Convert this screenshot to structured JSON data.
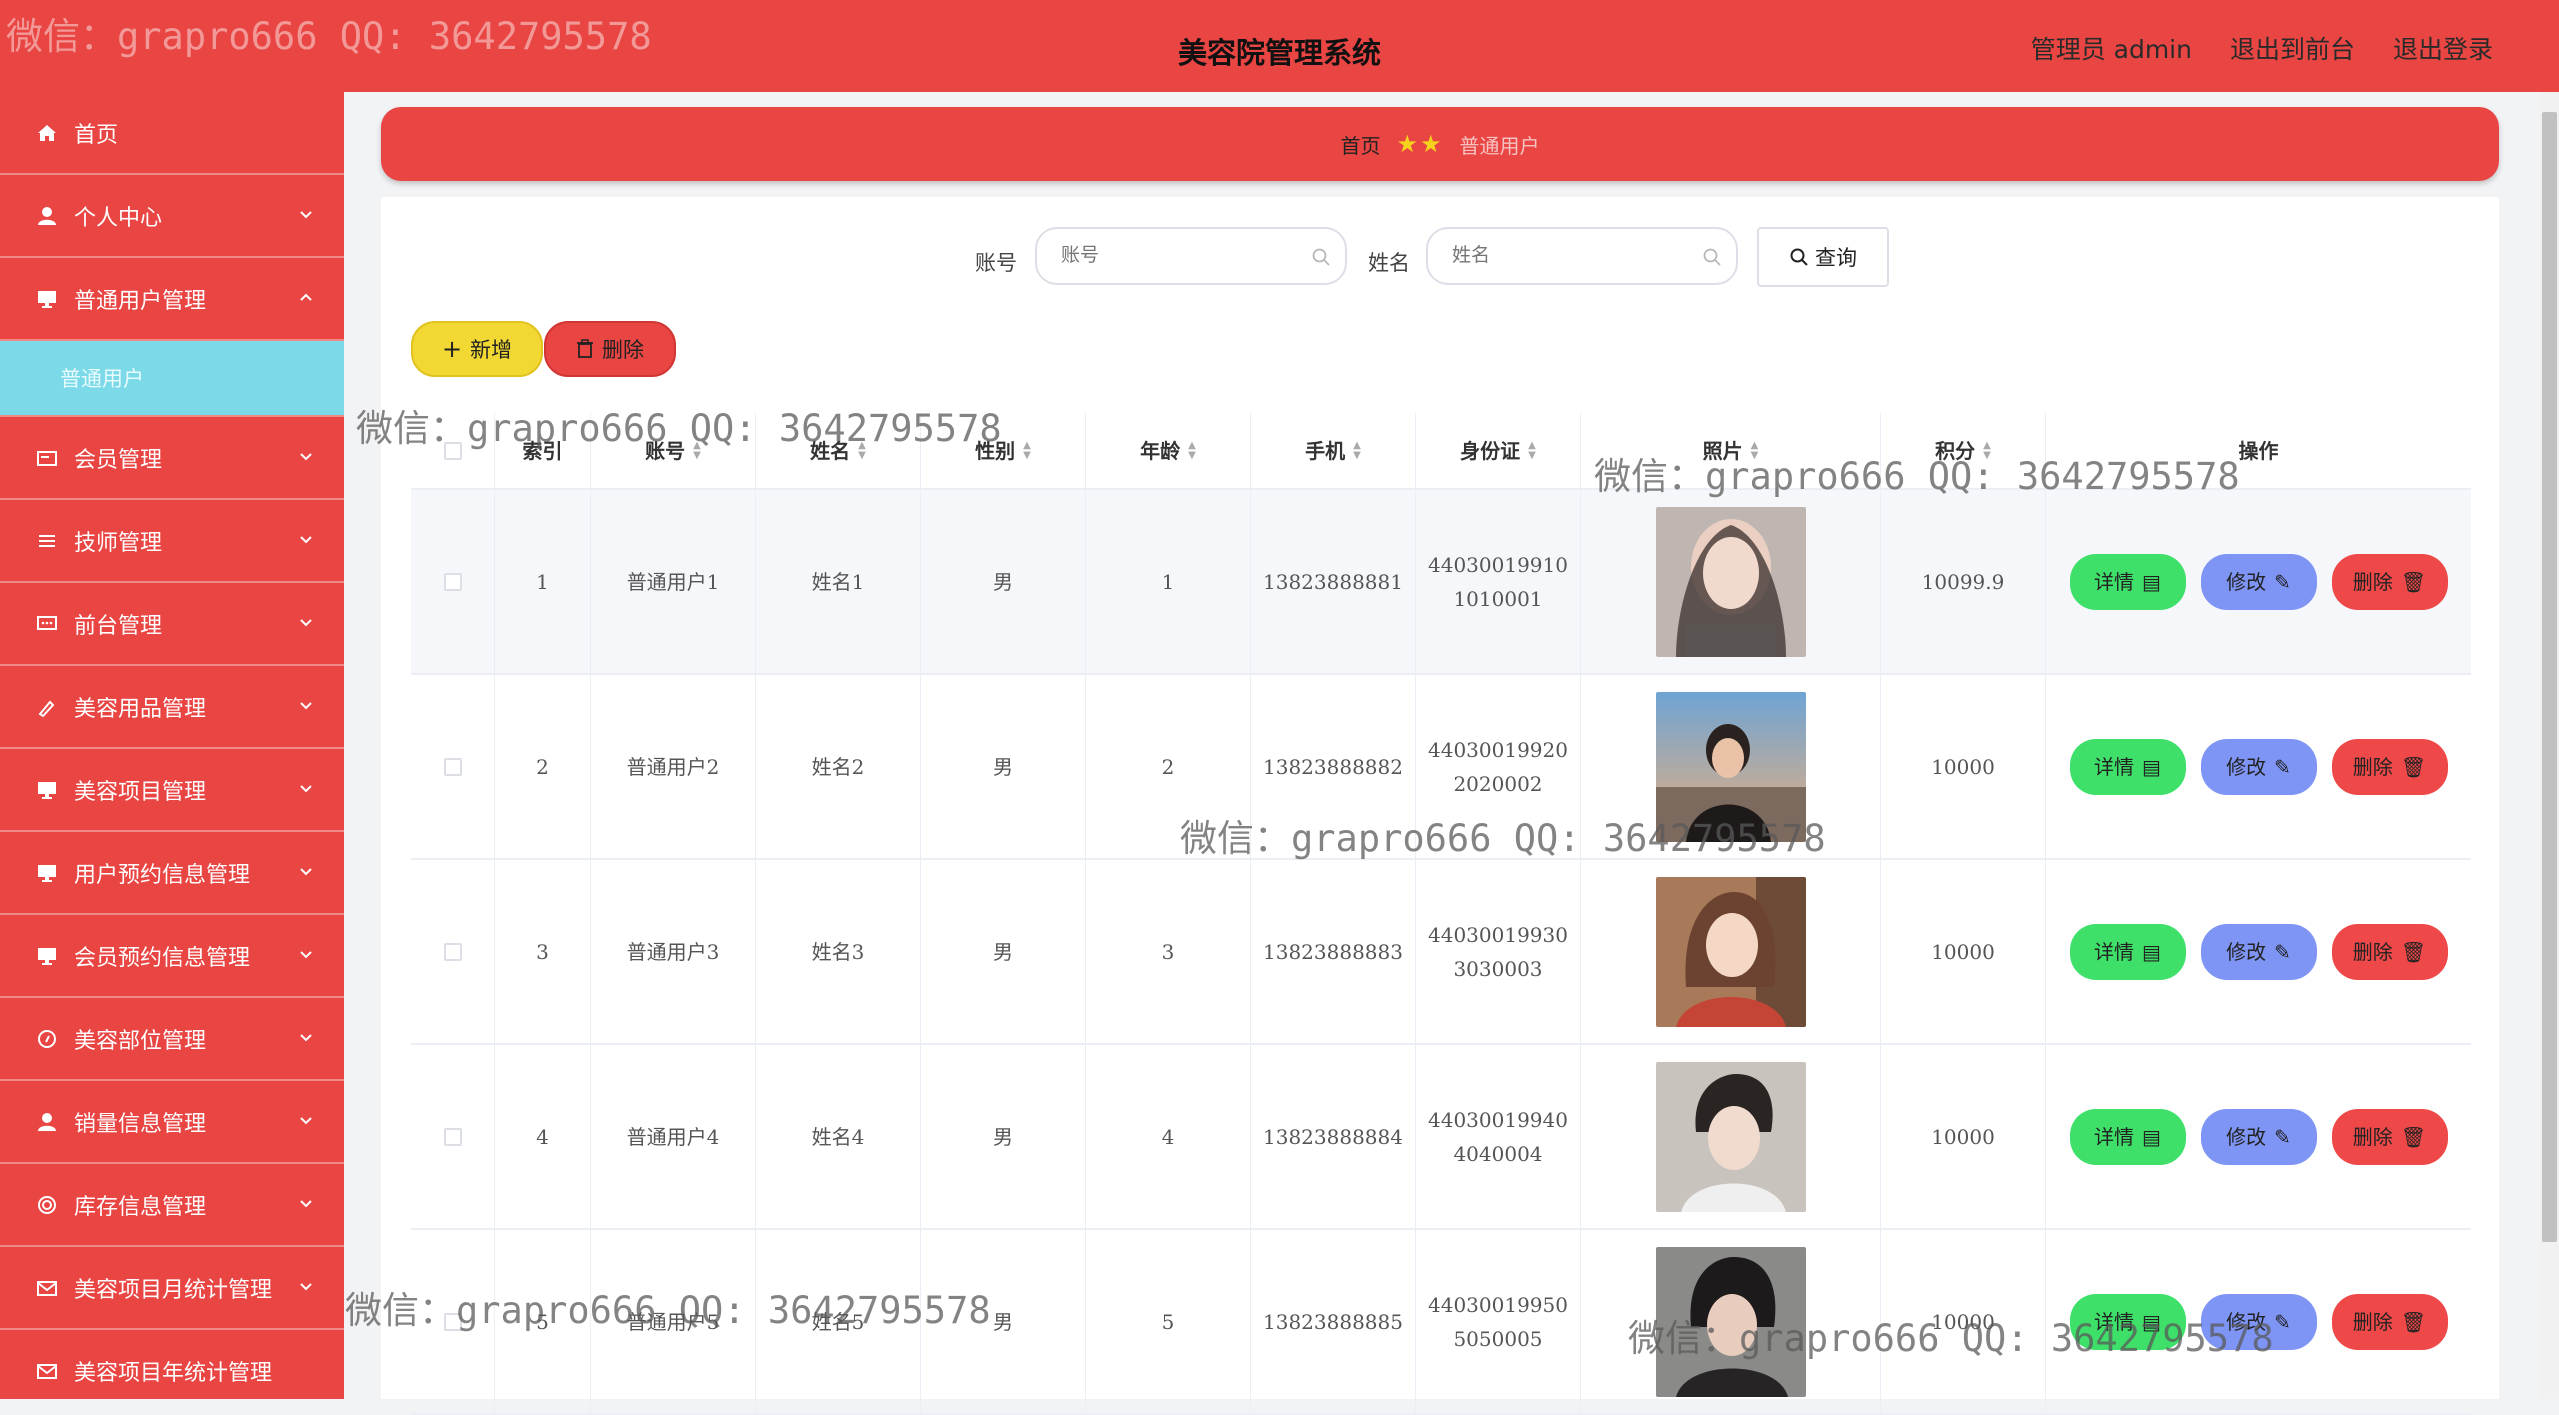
{
  "header": {
    "title": "美容院管理系统",
    "links": [
      "管理员 admin",
      "退出到前台",
      "退出登录"
    ]
  },
  "sidebar": {
    "items": [
      {
        "label": "首页",
        "icon": "home-icon",
        "has_children": false
      },
      {
        "label": "个人中心",
        "icon": "user-icon",
        "has_children": true
      },
      {
        "label": "普通用户管理",
        "icon": "monitor-icon",
        "has_children": true,
        "expanded": true
      },
      {
        "label": "会员管理",
        "icon": "card-icon",
        "has_children": true
      },
      {
        "label": "技师管理",
        "icon": "list-icon",
        "has_children": true
      },
      {
        "label": "前台管理",
        "icon": "chat-icon",
        "has_children": true
      },
      {
        "label": "美容用品管理",
        "icon": "brush-icon",
        "has_children": true
      },
      {
        "label": "美容项目管理",
        "icon": "monitor-icon",
        "has_children": true
      },
      {
        "label": "用户预约信息管理",
        "icon": "monitor-icon",
        "has_children": true
      },
      {
        "label": "会员预约信息管理",
        "icon": "monitor-icon",
        "has_children": true
      },
      {
        "label": "美容部位管理",
        "icon": "compass-icon",
        "has_children": true
      },
      {
        "label": "销量信息管理",
        "icon": "user-icon",
        "has_children": true
      },
      {
        "label": "库存信息管理",
        "icon": "target-icon",
        "has_children": true
      },
      {
        "label": "美容项目月统计管理",
        "icon": "mail-icon",
        "has_children": true
      },
      {
        "label": "美容项目年统计管理",
        "icon": "mail-icon",
        "has_children": true
      }
    ],
    "submenu_active": "普通用户"
  },
  "breadcrumb": {
    "home": "首页",
    "current": "普通用户"
  },
  "search": {
    "account_label": "账号",
    "account_placeholder": "账号",
    "name_label": "姓名",
    "name_placeholder": "姓名",
    "query_label": "查询"
  },
  "actions": {
    "add_label": "新增",
    "delete_label": "删除"
  },
  "table": {
    "columns": [
      "索引",
      "账号",
      "姓名",
      "性别",
      "年龄",
      "手机",
      "身份证",
      "照片",
      "积分",
      "操作"
    ],
    "rows": [
      {
        "index": "1",
        "account": "普通用户1",
        "name": "姓名1",
        "gender": "男",
        "age": "1",
        "phone": "13823888881",
        "id_line1": "44030019910",
        "id_line2": "1010001",
        "points": "10099.9"
      },
      {
        "index": "2",
        "account": "普通用户2",
        "name": "姓名2",
        "gender": "男",
        "age": "2",
        "phone": "13823888882",
        "id_line1": "44030019920",
        "id_line2": "2020002",
        "points": "10000"
      },
      {
        "index": "3",
        "account": "普通用户3",
        "name": "姓名3",
        "gender": "男",
        "age": "3",
        "phone": "13823888883",
        "id_line1": "44030019930",
        "id_line2": "3030003",
        "points": "10000"
      },
      {
        "index": "4",
        "account": "普通用户4",
        "name": "姓名4",
        "gender": "男",
        "age": "4",
        "phone": "13823888884",
        "id_line1": "44030019940",
        "id_line2": "4040004",
        "points": "10000"
      },
      {
        "index": "5",
        "account": "普通用户5",
        "name": "姓名5",
        "gender": "男",
        "age": "5",
        "phone": "13823888885",
        "id_line1": "44030019950",
        "id_line2": "5050005",
        "points": "10000"
      }
    ],
    "row_actions": {
      "detail": "详情",
      "edit": "修改",
      "delete": "删除"
    }
  },
  "watermark_text": "微信：grapro666 QQ: 3642795578",
  "colors": {
    "primary_red": "#e84543",
    "submenu_cyan": "#7cd9e8",
    "add_yellow": "#f2d833",
    "detail_green": "#3ee06a",
    "edit_blue": "#7f95f5",
    "delete_red": "#ee4848",
    "star_yellow": "#f7d21c"
  }
}
